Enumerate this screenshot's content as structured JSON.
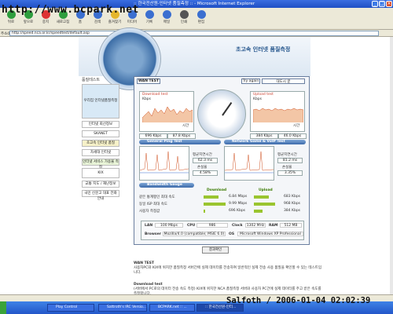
{
  "window": {
    "title": ":: 한국전산원-인터넷 품질측정 :: - Microsoft Internet Explorer"
  },
  "watermark": "http://www.bcpark.net",
  "toolbar": {
    "items": [
      "뒤로",
      "앞으로",
      "중지",
      "새로고침",
      "홈",
      "검색",
      "즐겨찾기",
      "미디어",
      "기록",
      "메일",
      "인쇄",
      "편집"
    ]
  },
  "address": {
    "label": "주소(D)",
    "value": "http://speed.nca.or.kr/speedtest/default.asp"
  },
  "banner": {
    "title": "초고속 인터넷 품질측정"
  },
  "left": {
    "section": "품질테스트",
    "items": [
      "우리집 인터넷품질측정",
      "인터넷 회선정보",
      "SKANET",
      "초고속 인터넷 품질",
      "차세대 인터넷",
      "인터넷 서비스 가용율 측정",
      "KIX",
      "교통 지도 / 재난정보",
      "국민 신문고 대표 전화 안내"
    ]
  },
  "panel": {
    "tabs": {
      "wan": "WAN TEST",
      "try": "Try again",
      "loc": "대도시 끝"
    },
    "download": {
      "title": "Download test",
      "unit": "Kbps",
      "time": "시간",
      "v1": "696 Kbps",
      "v2": "87.8 Kbps"
    },
    "upload": {
      "title": "Upload test",
      "unit": "Kbps",
      "time": "시간",
      "v1": "384 Kbps",
      "v2": "46.0 Kbps"
    },
    "ping": {
      "title": "General Ping Test",
      "l1": "평균지연시간",
      "v1": "62.3 ms",
      "l2": "손실율",
      "v2": "4.58%"
    },
    "game": {
      "title": "Network Game & VoIP Test",
      "l1": "평균지연시간",
      "v1": "81.2 ms",
      "l2": "손실율",
      "v2": "3.35%"
    },
    "bandwidth": {
      "title": "Bandwidth Gauge"
    },
    "bw": {
      "h1": "Download",
      "h2": "Upload",
      "rows": [
        {
          "label": "같은 통계평인 최대 속도",
          "d": "6.84 Mbps",
          "u": "683 Kbps"
        },
        {
          "label": "동일 ISP 최대 속도",
          "d": "9.99 Mbps",
          "u": "968 Kbps"
        },
        {
          "label": "사용자 측정값",
          "d": "696 Kbps",
          "u": "384 Kbps"
        }
      ]
    },
    "sys": {
      "lan": "LAN",
      "lan_v": "100 Mbps",
      "cpu": "CPU",
      "cpu_v": "986",
      "clock": "Clock",
      "clock_v": "1302 MHz",
      "ram": "RAM",
      "ram_v": "512 MB",
      "browser": "Browser",
      "browser_v": "Mozilla/4.0 (compatible; MSIE 6.0)",
      "os": "OS",
      "os_v": "Microsoft Windows XP Professional"
    }
  },
  "result_btn": "결과확인",
  "notes": [
    {
      "title": "WAN TEST",
      "text": "사용자PC와 KIX에 위치한 품질측정 서버간에 실제 데이터를 전송하여 일반적인 실제 전송 사용 품질을 확인할 수 있는 테스트입니다."
    },
    {
      "title": "Download test",
      "text": "(서버에서 PC로의 데이터 전송 속도 측정) KIX에 위치한 NCA 품질측정 서버와 사용자 PC간에 실제 데이터를 주고 받은 속도를 측정합니다."
    }
  ],
  "taskbar": {
    "items": [
      "Play Control",
      "Sattroth's IRC Versio...",
      "BCPARK.net :: ...",
      ":: 한국전산원-인터..."
    ]
  },
  "signature": "Salfoth / 2006-01-04 02:02:39"
}
